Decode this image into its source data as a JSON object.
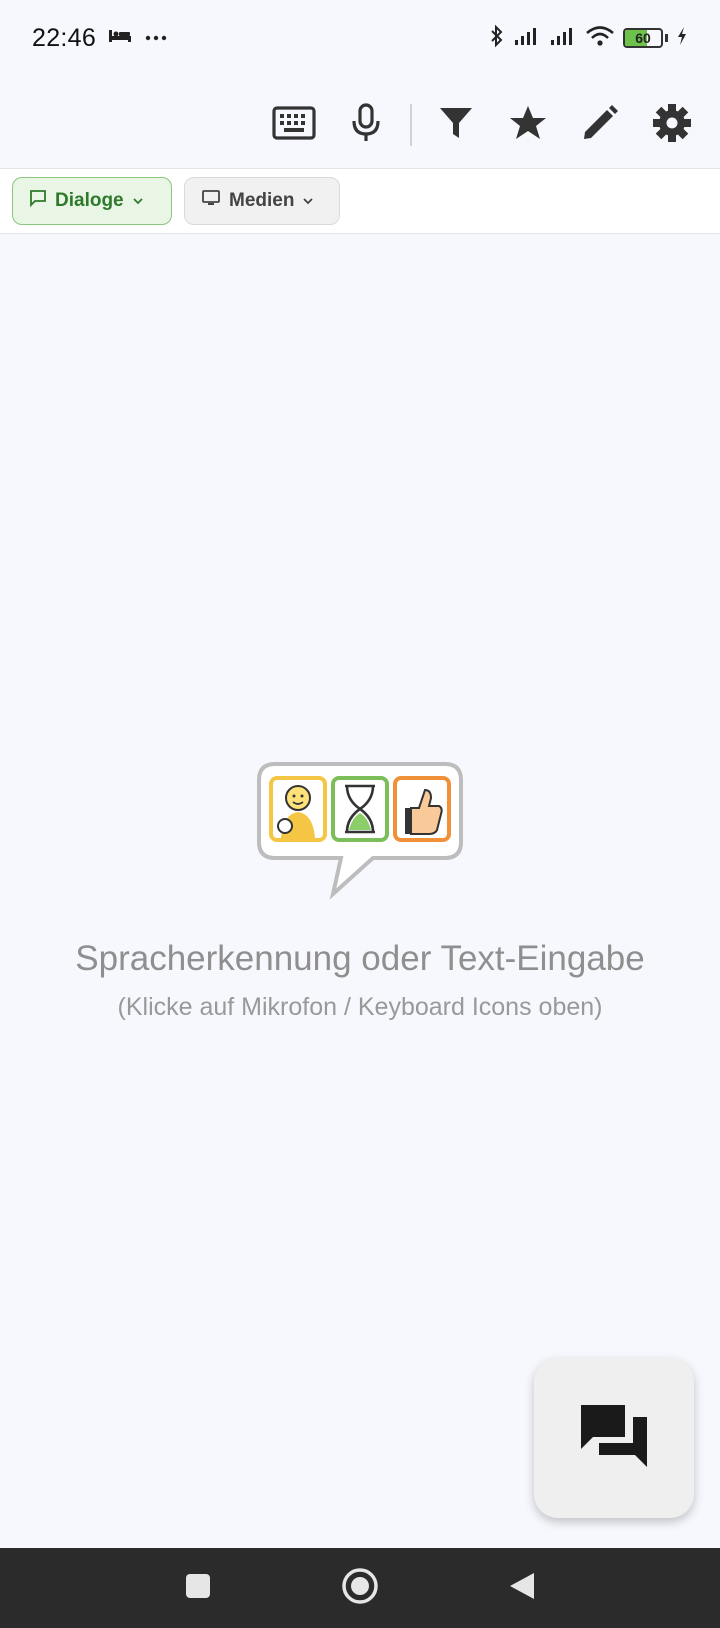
{
  "status_bar": {
    "time": "22:46",
    "battery_level": "60",
    "icons": [
      "sleep-icon",
      "more-dots-icon",
      "bluetooth-icon",
      "signal-icon",
      "signal-icon",
      "wifi-icon",
      "battery-icon",
      "charging-icon"
    ]
  },
  "toolbar": {
    "icons": [
      "keyboard-icon",
      "microphone-icon",
      "filter-icon",
      "star-icon",
      "pencil-icon",
      "gear-icon"
    ]
  },
  "filters": {
    "dialoge_label": "Dialoge",
    "medien_label": "Medien",
    "accent": "#2f7a2a"
  },
  "empty_state": {
    "title": "Spracherkennung oder Text-Eingabe",
    "subtitle": "(Klicke auf Mikrofon / Keyboard Icons oben)"
  },
  "fab": {
    "icon": "chat-bubbles-icon"
  },
  "nav_bar": {
    "icons": [
      "recents-icon",
      "home-icon",
      "back-icon"
    ]
  }
}
